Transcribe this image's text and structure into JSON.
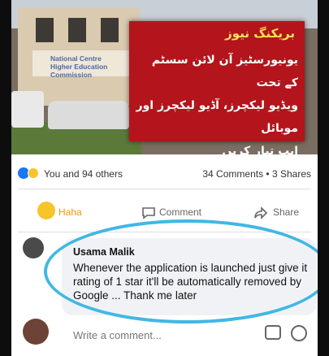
{
  "news": {
    "logo_text_line1": "National Centre",
    "logo_text_line2": "Higher Education Commission",
    "breaking_label": "بریکنگ نیوز",
    "body_line1": "یونیورسٹیز آن لائن سسٹم کے تحت",
    "body_line2": "ویڈیو لیکچرز، آڈیو لیکچرز اور موبائل",
    "body_line3": "ایپ تیار کریں",
    "accent_color": "#b4141c",
    "heading_color": "#ffe25a"
  },
  "reactions": {
    "icons": [
      "like-icon",
      "haha-icon"
    ],
    "text": "You and 94 others",
    "comments": "34 Comments",
    "separator": "•",
    "shares": "3 Shares"
  },
  "actions": {
    "haha_label": "Haha",
    "comment_label": "Comment",
    "share_label": "Share"
  },
  "comment": {
    "author": "Usama Malik",
    "text": "Whenever the application is launched just give it rating of 1 star it'll be automatically removed by Google ... Thank me later",
    "highlight_color": "#41b7e4"
  },
  "composer": {
    "placeholder": "Write a comment..."
  }
}
